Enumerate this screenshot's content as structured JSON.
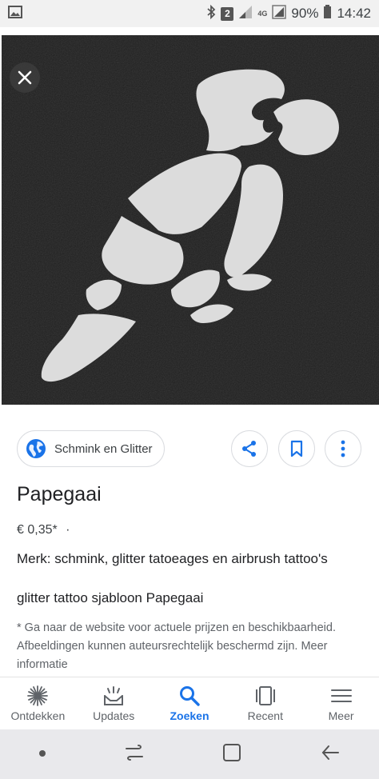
{
  "status_bar": {
    "sim_badge": "2",
    "network": "4G",
    "battery": "90%",
    "time": "14:42"
  },
  "viewer": {
    "image_desc": "black stencil with white parrot cut-out"
  },
  "info": {
    "source_name": "Schmink en Glitter",
    "title": "Papegaai",
    "price": "€ 0,35*",
    "price_dot": "·",
    "brand": "Merk: schmink, glitter tatoeages en airbrush tattoo's",
    "description": "glitter tattoo sjabloon Papegaai",
    "disclaimer": "* Ga naar de website voor actuele prijzen en beschikbaarheid. Afbeeldingen kunnen auteursrechtelijk beschermd zijn. Meer informatie"
  },
  "bottom_nav": {
    "items": [
      {
        "label": "Ontdekken",
        "icon": "asterisk-icon"
      },
      {
        "label": "Updates",
        "icon": "updates-icon"
      },
      {
        "label": "Zoeken",
        "icon": "search-icon"
      },
      {
        "label": "Recent",
        "icon": "recent-icon"
      },
      {
        "label": "Meer",
        "icon": "menu-icon"
      }
    ],
    "active": "Zoeken"
  },
  "colors": {
    "accent": "#1a73e8",
    "stencil": "#1e1e1e",
    "cutout": "#dcdcdc"
  }
}
